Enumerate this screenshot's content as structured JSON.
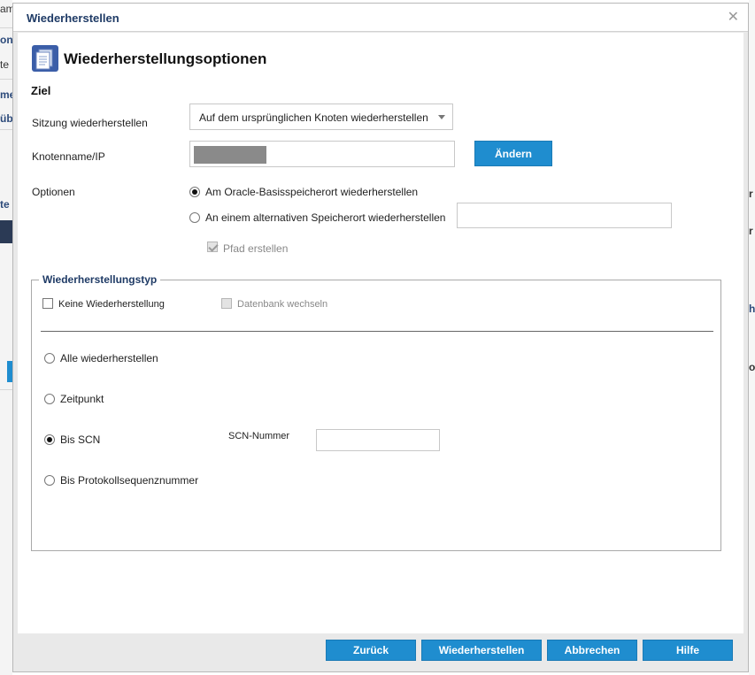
{
  "background": {
    "fragments": [
      "am",
      "oni",
      "te",
      "me",
      "üb",
      "te I",
      "o"
    ],
    "right_fragments": [
      "r",
      "r",
      "h",
      "o"
    ]
  },
  "dialog": {
    "title": "Wiederherstellen",
    "close_icon": "close-icon",
    "header_title": "Wiederherstellungsoptionen",
    "header_icon": "document-stack-icon"
  },
  "ziel": {
    "section_label": "Ziel",
    "session_label": "Sitzung wiederherstellen",
    "session_value": "Auf dem ursprünglichen Knoten wiederherstellen",
    "node_label": "Knotenname/IP",
    "change_button": "Ändern",
    "options_label": "Optionen",
    "option_original": "Am Oracle-Basisspeicherort wiederherstellen",
    "option_alternative": "An einem alternativen Speicherort wiederherstellen",
    "option_selected": "original",
    "alt_path_value": "",
    "create_path_label": "Pfad erstellen",
    "create_path_checked": true
  },
  "restore_type": {
    "legend": "Wiederherstellungstyp",
    "no_restore_label": "Keine Wiederherstellung",
    "no_restore_checked": false,
    "switch_db_label": "Datenbank wechseln",
    "switch_db_checked": false,
    "options": [
      "Alle wiederherstellen",
      "Zeitpunkt",
      "Bis SCN",
      "Bis Protokollsequenznummer"
    ],
    "selected": "Bis SCN",
    "scn_label": "SCN-Nummer",
    "scn_value": ""
  },
  "footer": {
    "back": "Zurück",
    "restore": "Wiederherstellen",
    "cancel": "Abbrechen",
    "help": "Hilfe"
  },
  "colors": {
    "accent": "#1f8dcf",
    "title_text": "#1f3b66"
  }
}
